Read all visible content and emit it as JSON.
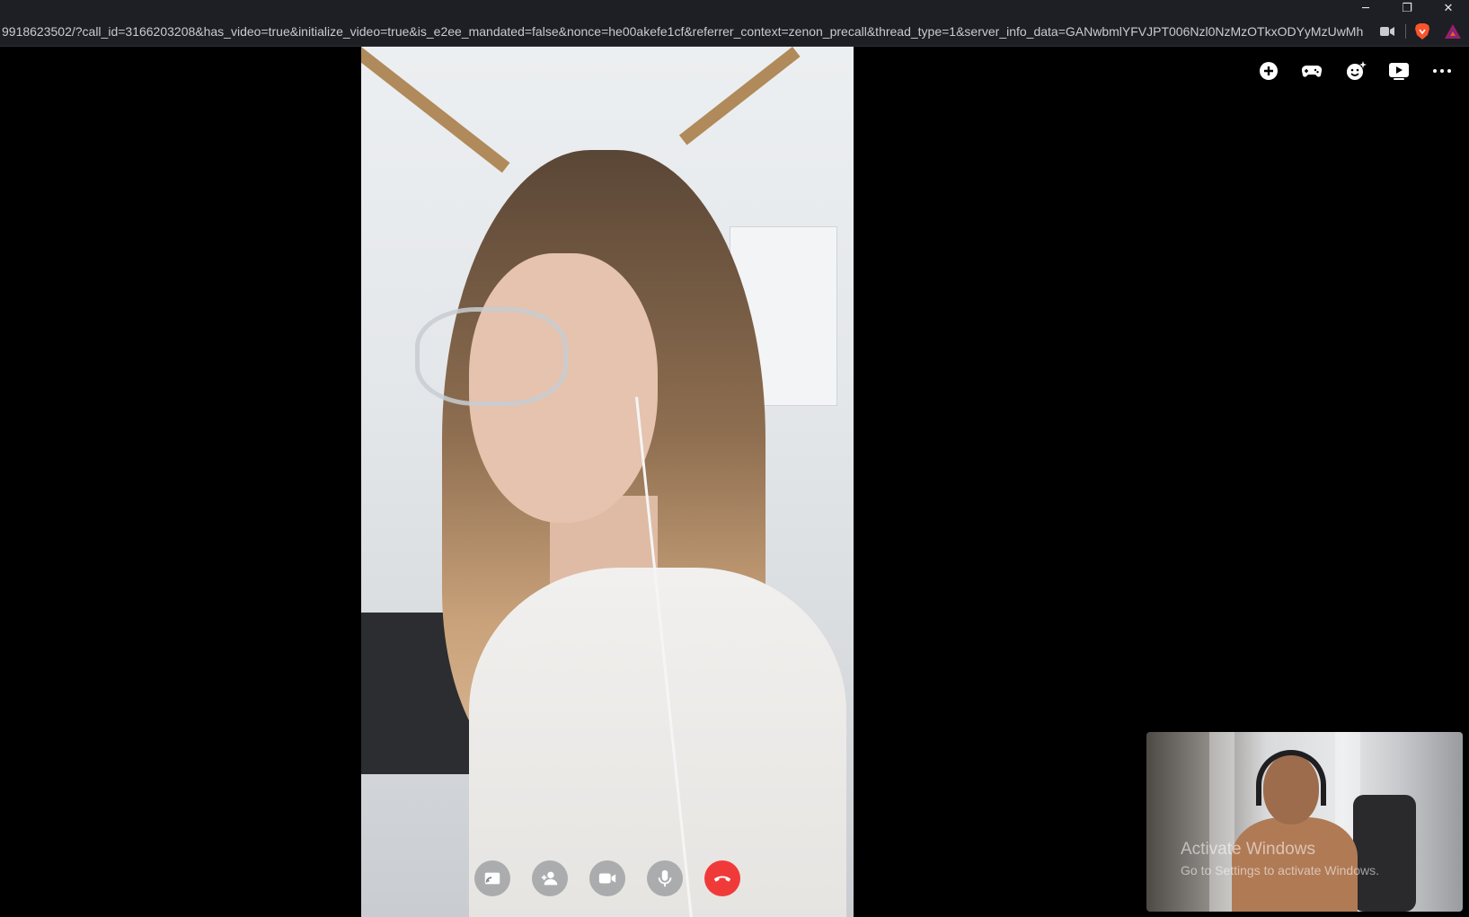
{
  "window": {
    "minimize_glyph": "─",
    "restore_glyph": "❐",
    "close_glyph": "✕"
  },
  "address_bar": {
    "url": "9918623502/?call_id=3166203208&has_video=true&initialize_video=true&is_e2ee_mandated=false&nonce=he00akefe1cf&referrer_context=zenon_precall&thread_type=1&server_info_data=GANwbmlYFVJPT006Nzl0NzMzOTkxODYyMzUwMhg...",
    "icons": [
      "camera-icon",
      "brave-lion-icon",
      "brave-rewards-icon"
    ]
  },
  "call": {
    "top_toolbar": [
      "add-icon",
      "games-icon",
      "effects-icon",
      "watch-together-icon",
      "more-icon"
    ],
    "controls": [
      "share-screen-icon",
      "add-person-icon",
      "video-camera-icon",
      "microphone-icon",
      "end-call-icon"
    ],
    "colors": {
      "end_call": "#f03a3a",
      "background": "#000000"
    }
  },
  "watermark": {
    "title": "Activate Windows",
    "subtitle": "Go to Settings to activate Windows."
  }
}
